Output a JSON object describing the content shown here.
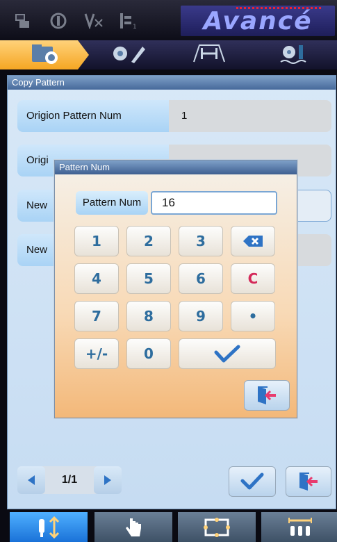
{
  "brand": {
    "name": "Avancé"
  },
  "status_icons": [
    "network-icon",
    "needle-mode-icon",
    "thread-cut-icon",
    "stitch-counter-icon"
  ],
  "step_nav": {
    "steps": [
      "pattern-folder-icon",
      "edit-pattern-icon",
      "stitch-adjust-icon",
      "sewing-icon"
    ],
    "active_index": 0
  },
  "panel": {
    "title": "Copy Pattern",
    "rows": [
      {
        "label": "Origion Pattern Num",
        "value": "1"
      },
      {
        "label": "Origi",
        "value": ""
      },
      {
        "label": "New",
        "value": ""
      },
      {
        "label": "New",
        "value": ""
      }
    ],
    "pager": {
      "text": "1/1"
    }
  },
  "dialog": {
    "title": "Pattern Num",
    "field_label": "Pattern Num",
    "field_value": "16",
    "keys": [
      "1",
      "2",
      "3",
      "⌫",
      "4",
      "5",
      "6",
      "C",
      "7",
      "8",
      "9",
      "•",
      "+/-",
      "0",
      "✓"
    ]
  },
  "bottom_tabs": {
    "items": [
      "stitch-select-icon",
      "manual-hand-icon",
      "frame-icon",
      "needle-row-icon"
    ],
    "active_index": 0
  },
  "colors": {
    "accent_orange": "#f5a623",
    "panel_blue": "#c6dcf2",
    "key_text": "#2e6d9e",
    "clear_red": "#d42a5a"
  }
}
